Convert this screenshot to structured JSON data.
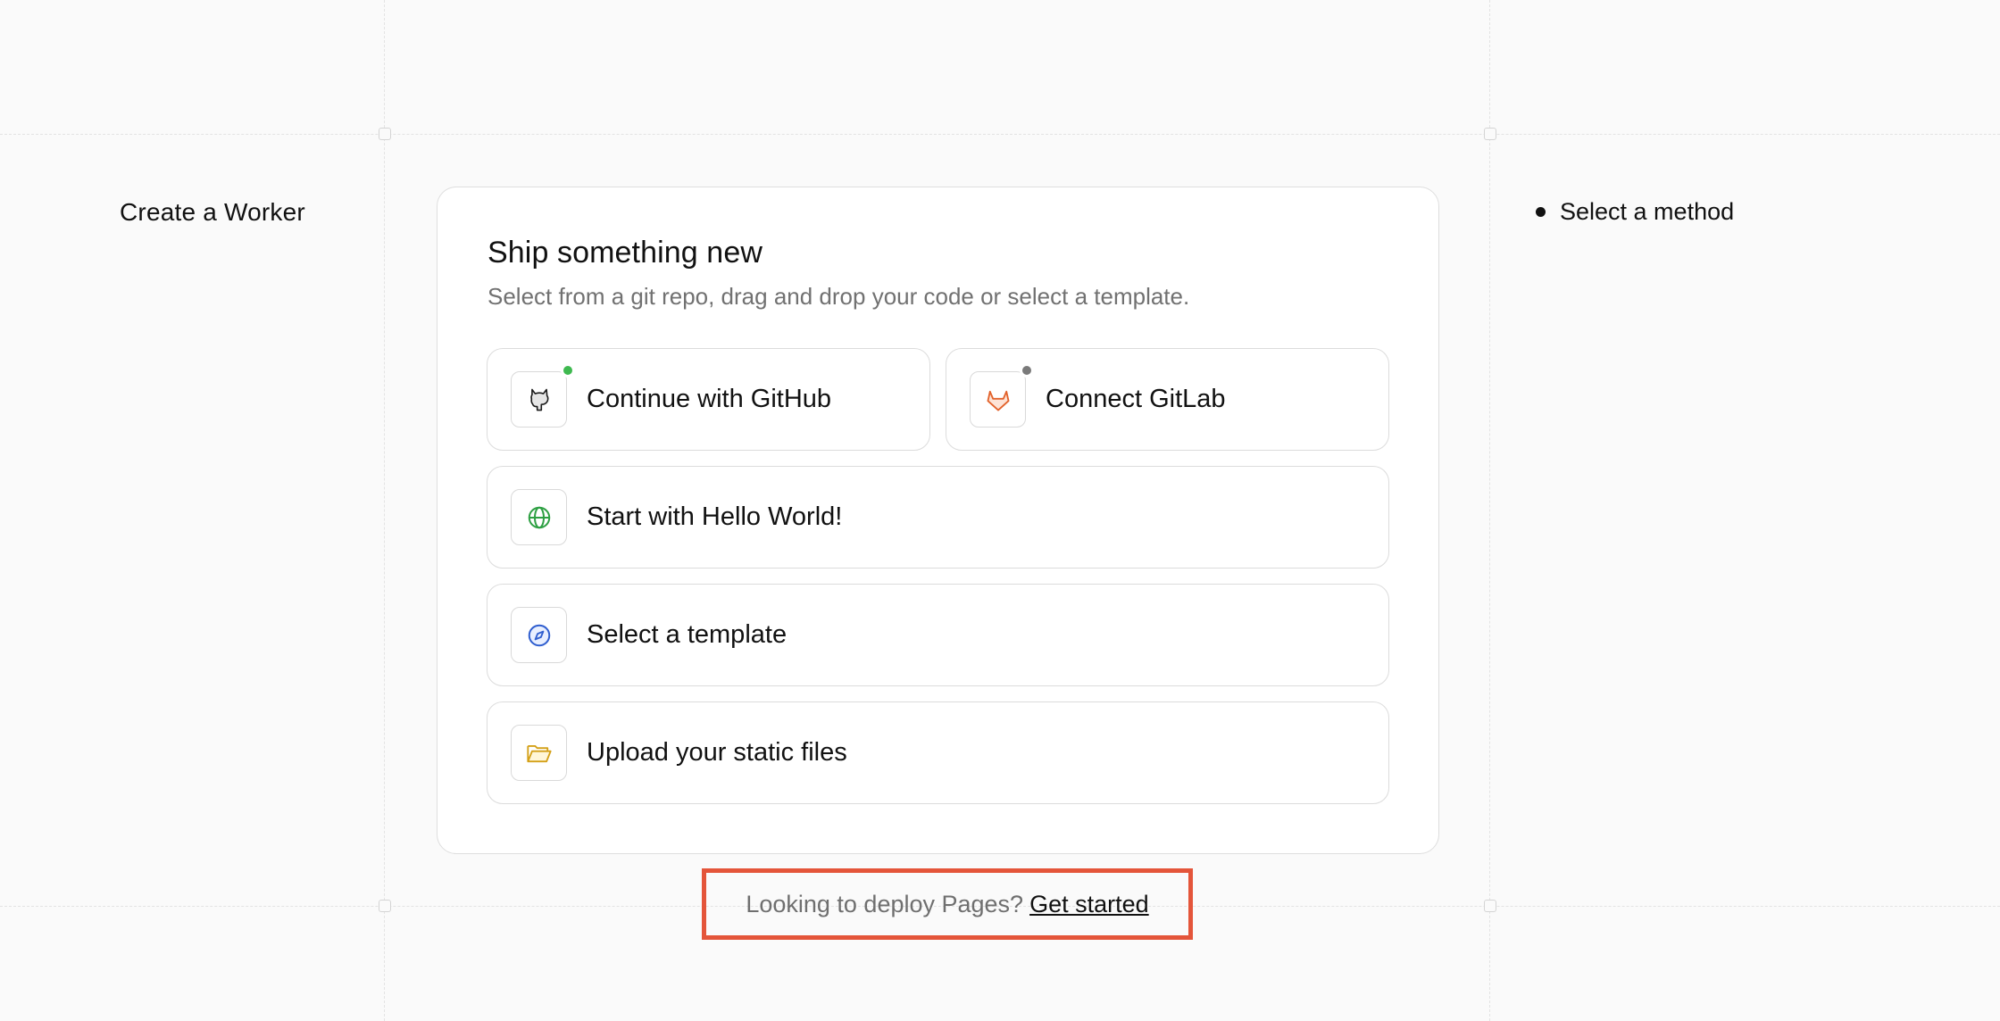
{
  "page": {
    "left_title": "Create a Worker",
    "stepper": {
      "items": [
        {
          "label": "Select a method"
        }
      ]
    }
  },
  "card": {
    "title": "Ship something new",
    "subtitle": "Select from a git repo, drag and drop your code or select a template.",
    "options": {
      "github": {
        "label": "Continue with GitHub",
        "icon": "github-icon",
        "status_color": "#3fb950"
      },
      "gitlab": {
        "label": "Connect GitLab",
        "icon": "gitlab-icon",
        "status_color": "#7a7a7a"
      },
      "hello_world": {
        "label": "Start with Hello World!",
        "icon": "globe-icon",
        "icon_color": "#2ea043"
      },
      "template": {
        "label": "Select a template",
        "icon": "compass-icon",
        "icon_color": "#2f5ecf"
      },
      "upload": {
        "label": "Upload your static files",
        "icon": "folder-icon",
        "icon_color": "#d4a017"
      }
    }
  },
  "footer": {
    "text": "Looking to deploy Pages?",
    "link": "Get started",
    "highlight_color": "#e4553a"
  }
}
